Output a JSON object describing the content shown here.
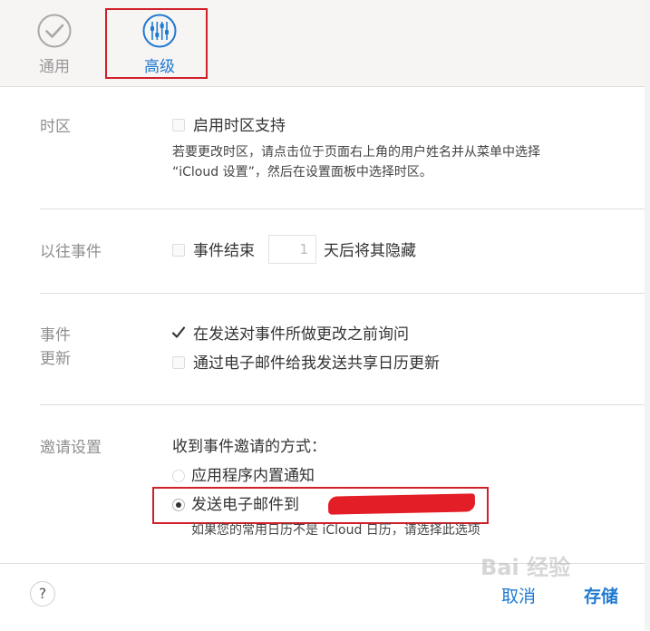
{
  "tabs": [
    {
      "label": "通用",
      "icon": "checkmark-icon"
    },
    {
      "label": "高级",
      "icon": "sliders-icon"
    }
  ],
  "timezone": {
    "section_label": "时区",
    "checkbox_label": "启用时区支持",
    "hint_line1": "若要更改时区，请点击位于页面右上角的用户姓名并从菜单中选择",
    "hint_line2": "“iCloud 设置”，然后在设置面板中选择时区。"
  },
  "past_events": {
    "section_label": "以往事件",
    "label_before": "事件结束",
    "days_value": "1",
    "label_after": "天后将其隐藏"
  },
  "event_updates": {
    "section_label_line1": "事件",
    "section_label_line2": "更新",
    "option1": "在发送对事件所做更改之前询问",
    "option2": "通过电子邮件给我发送共享日历更新"
  },
  "invitations": {
    "section_label": "邀请设置",
    "heading": "收到事件邀请的方式：",
    "option1": "应用程序内置通知",
    "option2": "发送电子邮件到",
    "hint": "如果您的常用日历不是 iCloud 日历，请选择此选项"
  },
  "footer": {
    "help_label": "?",
    "cancel_label": "取消",
    "save_label": "存储"
  },
  "watermark": "Bai 经验",
  "colors": {
    "accent": "#1f7ad1",
    "highlight": "#d0212b"
  }
}
